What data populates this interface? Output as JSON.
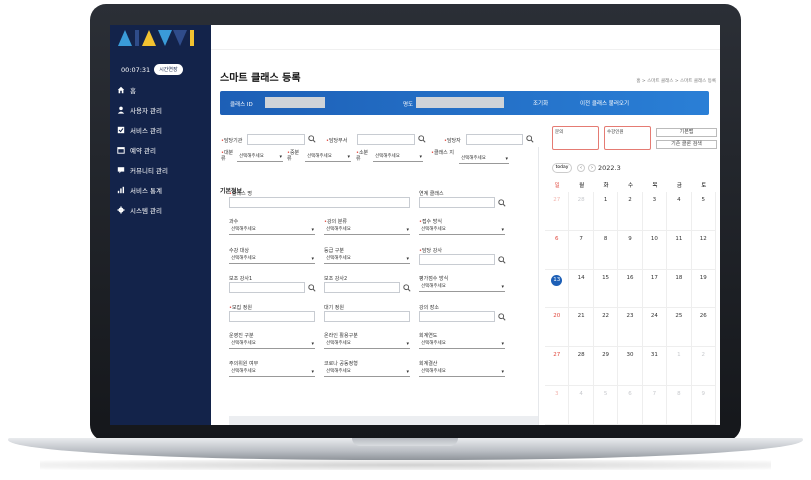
{
  "logo_text": "AIAVVI",
  "sidebar": {
    "timer": "00:07:31",
    "timer_button": "시간연장",
    "items": [
      {
        "label": "홈",
        "icon": "home-icon"
      },
      {
        "label": "사용자 관리",
        "icon": "user-icon"
      },
      {
        "label": "서비스 관리",
        "icon": "checkbox-icon"
      },
      {
        "label": "예약 관리",
        "icon": "calendar-icon"
      },
      {
        "label": "커뮤니티 관리",
        "icon": "chat-icon"
      },
      {
        "label": "서비스 통계",
        "icon": "bar-chart-icon"
      },
      {
        "label": "시스템 관리",
        "icon": "gear-icon"
      }
    ]
  },
  "page": {
    "title": "스마트 클래스 등록",
    "breadcrumb": "홈 > 스마트 클래스 > 스마트 클래스 등록"
  },
  "bluebar": {
    "label1": "클래스 ID",
    "label2": "명도",
    "button1": "조기화",
    "button2": "이전 클래스 불러오기"
  },
  "filters": {
    "row1": [
      {
        "label": "담당기관",
        "required": true
      },
      {
        "label": "담당부서",
        "required": true
      },
      {
        "label": "담당자",
        "required": true
      }
    ],
    "row2": [
      {
        "label": "대분류",
        "value": "선택해주세요",
        "required": true
      },
      {
        "label": "중분류",
        "value": "선택해주세요",
        "required": true
      },
      {
        "label": "소분류",
        "value": "선택해주세요",
        "required": true
      },
      {
        "label": "클래스 지",
        "value": "선택해주세요",
        "required": true
      }
    ]
  },
  "right_panel": {
    "box1_label": "문의",
    "box2_label": "수강인원",
    "btn1": "기본맵",
    "btn2": "기존 클론 검색",
    "today": "today",
    "prev": "‹",
    "next": "›",
    "month": "2022.3"
  },
  "form": {
    "section_title": "기본정보",
    "fields": [
      {
        "label": "클래스 명",
        "required": true,
        "type": "input"
      },
      {
        "label": "연계 클래스",
        "required": false,
        "type": "search"
      },
      {
        "label": "과수",
        "required": false,
        "type": "select",
        "value": "선택해주세요"
      },
      {
        "label": "강의 분류",
        "required": true,
        "type": "select",
        "value": "선택해주세요"
      },
      {
        "label": "접수 방식",
        "required": true,
        "type": "select",
        "value": "선택해주세요"
      },
      {
        "label": "수강 대상",
        "required": false,
        "type": "select",
        "value": "선택해주세요"
      },
      {
        "label": "등급 구분",
        "required": false,
        "type": "select",
        "value": "선택해주세요"
      },
      {
        "label": "담당 강사",
        "required": true,
        "type": "search"
      },
      {
        "label": "보조 강사1",
        "required": false,
        "type": "search"
      },
      {
        "label": "보조 강사2",
        "required": false,
        "type": "search"
      },
      {
        "label": "평가점수 방식",
        "required": false,
        "type": "select",
        "value": "선택해주세요"
      },
      {
        "label": "모집 정원",
        "required": true,
        "type": "input"
      },
      {
        "label": "대기 정원",
        "required": false,
        "type": "input"
      },
      {
        "label": "강의 장소",
        "required": false,
        "type": "search"
      },
      {
        "label": "운영진 구분",
        "required": false,
        "type": "select",
        "value": "선택해주세요"
      },
      {
        "label": "온라인 활용구분",
        "required": false,
        "type": "select",
        "value": "선택해주세요"
      },
      {
        "label": "회계연도",
        "required": false,
        "type": "select",
        "value": "선택해주세요"
      },
      {
        "label": "주의위원 여부",
        "required": false,
        "type": "select",
        "value": "선택해주세요"
      },
      {
        "label": "코로나 공동정형",
        "required": false,
        "type": "select",
        "value": "선택해주세요"
      },
      {
        "label": "회계결산",
        "required": false,
        "type": "select",
        "value": "선택해주세요"
      }
    ]
  },
  "calendar": {
    "weekdays": [
      "일",
      "월",
      "화",
      "수",
      "목",
      "금",
      "토"
    ],
    "weeks": [
      [
        "27",
        "28",
        "1",
        "2",
        "3",
        "4",
        "5"
      ],
      [
        "6",
        "7",
        "8",
        "9",
        "10",
        "11",
        "12"
      ],
      [
        "13",
        "14",
        "15",
        "16",
        "17",
        "18",
        "19"
      ],
      [
        "20",
        "21",
        "22",
        "23",
        "24",
        "25",
        "26"
      ],
      [
        "27",
        "28",
        "29",
        "30",
        "31",
        "1",
        "2"
      ],
      [
        "3",
        "4",
        "5",
        "6",
        "7",
        "8",
        "9"
      ]
    ],
    "today": "13"
  },
  "colors": {
    "sidebar": "#13234a",
    "accent": "#1d5fb6",
    "required": "#e0463b",
    "logo": [
      "#3a9bd8",
      "#2f4c8a",
      "#f2c230",
      "#2f4c8a",
      "#f2c230",
      "#3a9bd8"
    ]
  }
}
